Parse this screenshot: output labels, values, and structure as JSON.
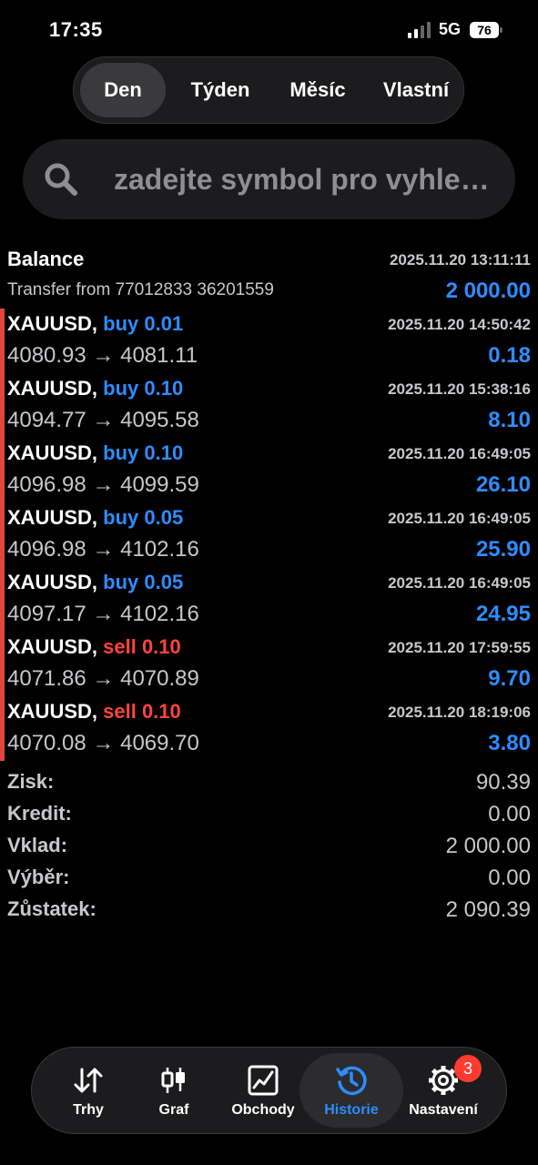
{
  "status": {
    "time": "17:35",
    "network": "5G",
    "battery": "76"
  },
  "period_tabs": [
    {
      "label": "Den",
      "active": true
    },
    {
      "label": "Týden",
      "active": false
    },
    {
      "label": "Měsíc",
      "active": false
    },
    {
      "label": "Vlastní",
      "active": false
    }
  ],
  "search": {
    "placeholder": "zadejte symbol pro vyhle…"
  },
  "balance": {
    "title": "Balance",
    "date": "2025.11.20 13:11:11",
    "description": "Transfer from 77012833 36201559",
    "amount": "2 000.00"
  },
  "deals": [
    {
      "symbol": "XAUUSD,",
      "side": "buy 0.01",
      "type": "buy",
      "date": "2025.11.20 14:50:42",
      "prices": "4080.93 → 4081.11",
      "profit": "0.18"
    },
    {
      "symbol": "XAUUSD,",
      "side": "buy 0.10",
      "type": "buy",
      "date": "2025.11.20 15:38:16",
      "prices": "4094.77 → 4095.58",
      "profit": "8.10"
    },
    {
      "symbol": "XAUUSD,",
      "side": "buy 0.10",
      "type": "buy",
      "date": "2025.11.20 16:49:05",
      "prices": "4096.98 → 4099.59",
      "profit": "26.10"
    },
    {
      "symbol": "XAUUSD,",
      "side": "buy 0.05",
      "type": "buy",
      "date": "2025.11.20 16:49:05",
      "prices": "4096.98 → 4102.16",
      "profit": "25.90"
    },
    {
      "symbol": "XAUUSD,",
      "side": "buy 0.05",
      "type": "buy",
      "date": "2025.11.20 16:49:05",
      "prices": "4097.17 → 4102.16",
      "profit": "24.95"
    },
    {
      "symbol": "XAUUSD,",
      "side": "sell 0.10",
      "type": "sell",
      "date": "2025.11.20 17:59:55",
      "prices": "4071.86 → 4070.89",
      "profit": "9.70"
    },
    {
      "symbol": "XAUUSD,",
      "side": "sell 0.10",
      "type": "sell",
      "date": "2025.11.20 18:19:06",
      "prices": "4070.08 → 4069.70",
      "profit": "3.80"
    }
  ],
  "summary": [
    {
      "label": "Zisk:",
      "value": "90.39"
    },
    {
      "label": "Kredit:",
      "value": "0.00"
    },
    {
      "label": "Vklad:",
      "value": "2 000.00"
    },
    {
      "label": "Výběr:",
      "value": "0.00"
    },
    {
      "label": "Zůstatek:",
      "value": "2 090.39"
    }
  ],
  "tabbar": [
    {
      "label": "Trhy",
      "icon": "arrows-updown-icon",
      "active": false
    },
    {
      "label": "Graf",
      "icon": "candlestick-icon",
      "active": false
    },
    {
      "label": "Obchody",
      "icon": "trade-chart-icon",
      "active": false
    },
    {
      "label": "Historie",
      "icon": "history-clock-icon",
      "active": true
    },
    {
      "label": "Nastavení",
      "icon": "gear-icon",
      "active": false,
      "badge": "3"
    }
  ],
  "colors": {
    "buy": "#2f8cff",
    "sell": "#ff453a",
    "accent": "#2f8cff",
    "deal_bar": "#e5443a",
    "badge": "#ff3b30"
  }
}
